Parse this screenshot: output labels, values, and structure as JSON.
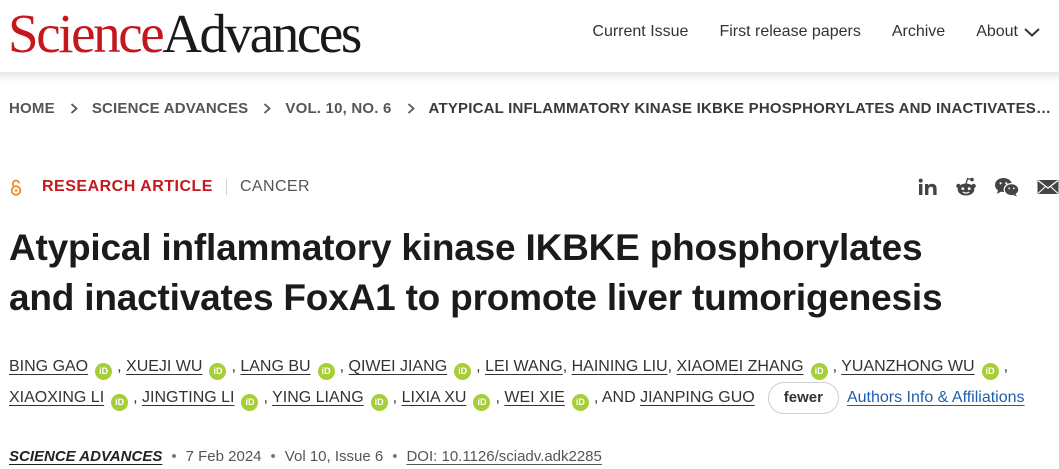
{
  "header": {
    "logo_part1": "Science",
    "logo_part2": "Advances",
    "logo_colors": {
      "science": "#c4171e",
      "advances": "#1a1a1a"
    },
    "nav": [
      {
        "label": "Current Issue"
      },
      {
        "label": "First release papers"
      },
      {
        "label": "Archive"
      },
      {
        "label": "About",
        "icon": "chevron-down-icon"
      }
    ]
  },
  "breadcrumb": [
    "HOME",
    "SCIENCE ADVANCES",
    "VOL. 10, NO. 6",
    "ATYPICAL INFLAMMATORY KINASE IKBKE PHOSPHORYLATES AND INACTIVATES…"
  ],
  "article": {
    "type": "RESEARCH ARTICLE",
    "subject": "CANCER",
    "accent_color": "#c4171e",
    "share_icons": [
      "linkedin-icon",
      "reddit-icon",
      "wechat-icon",
      "email-icon"
    ],
    "title_line1": "Atypical inflammatory kinase IKBKE phosphorylates",
    "title_line2": "and inactivates FoxA1 to promote liver tumorigenesis",
    "authors": [
      {
        "name": "BING GAO",
        "orcid": true
      },
      {
        "name": "XUEJI WU",
        "orcid": true
      },
      {
        "name": "LANG BU",
        "orcid": true
      },
      {
        "name": "QIWEI JIANG",
        "orcid": true
      },
      {
        "name": "LEI WANG",
        "orcid": false
      },
      {
        "name": "HAINING LIU",
        "orcid": false
      },
      {
        "name": "XIAOMEI ZHANG",
        "orcid": true
      },
      {
        "name": "YUANZHONG WU",
        "orcid": true
      },
      {
        "name": "XIAOXING LI",
        "orcid": true
      },
      {
        "name": "JINGTING LI",
        "orcid": true
      },
      {
        "name": "YING LIANG",
        "orcid": true
      },
      {
        "name": "LIXIA XU",
        "orcid": true
      },
      {
        "name": "WEI XIE",
        "orcid": true
      },
      {
        "name": "JIANPING GUO",
        "orcid": false
      }
    ],
    "and_text": "AND",
    "orcid_badge": "iD",
    "fewer_label": "fewer",
    "affiliations_label": "Authors Info & Affiliations",
    "journal": "SCIENCE ADVANCES",
    "date": "7 Feb 2024",
    "volume_issue": "Vol 10, Issue 6",
    "doi": "DOI: 10.1126/sciadv.adk2285"
  }
}
